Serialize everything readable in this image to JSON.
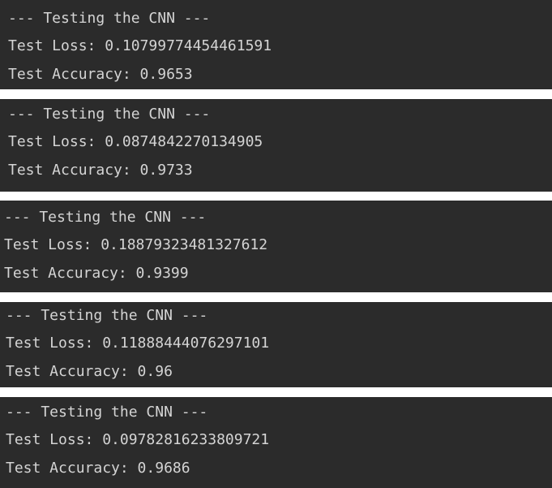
{
  "outputs": [
    {
      "header": "--- Testing the CNN ---",
      "loss_line": "Test Loss: 0.10799774454461591",
      "accuracy_line": "Test Accuracy: 0.9653"
    },
    {
      "header": "--- Testing the CNN ---",
      "loss_line": "Test Loss: 0.0874842270134905",
      "accuracy_line": "Test Accuracy: 0.9733"
    },
    {
      "header": "--- Testing the CNN ---",
      "loss_line": "Test Loss: 0.18879323481327612",
      "accuracy_line": "Test Accuracy: 0.9399"
    },
    {
      "header": "--- Testing the CNN ---",
      "loss_line": "Test Loss: 0.11888444076297101",
      "accuracy_line": "Test Accuracy: 0.96"
    },
    {
      "header": "--- Testing the CNN ---",
      "loss_line": "Test Loss: 0.09782816233809721",
      "accuracy_line": "Test Accuracy: 0.9686"
    }
  ],
  "colors": {
    "panel_background": "#2b2b2b",
    "text": "#d4d4d4",
    "separator": "#ffffff"
  }
}
